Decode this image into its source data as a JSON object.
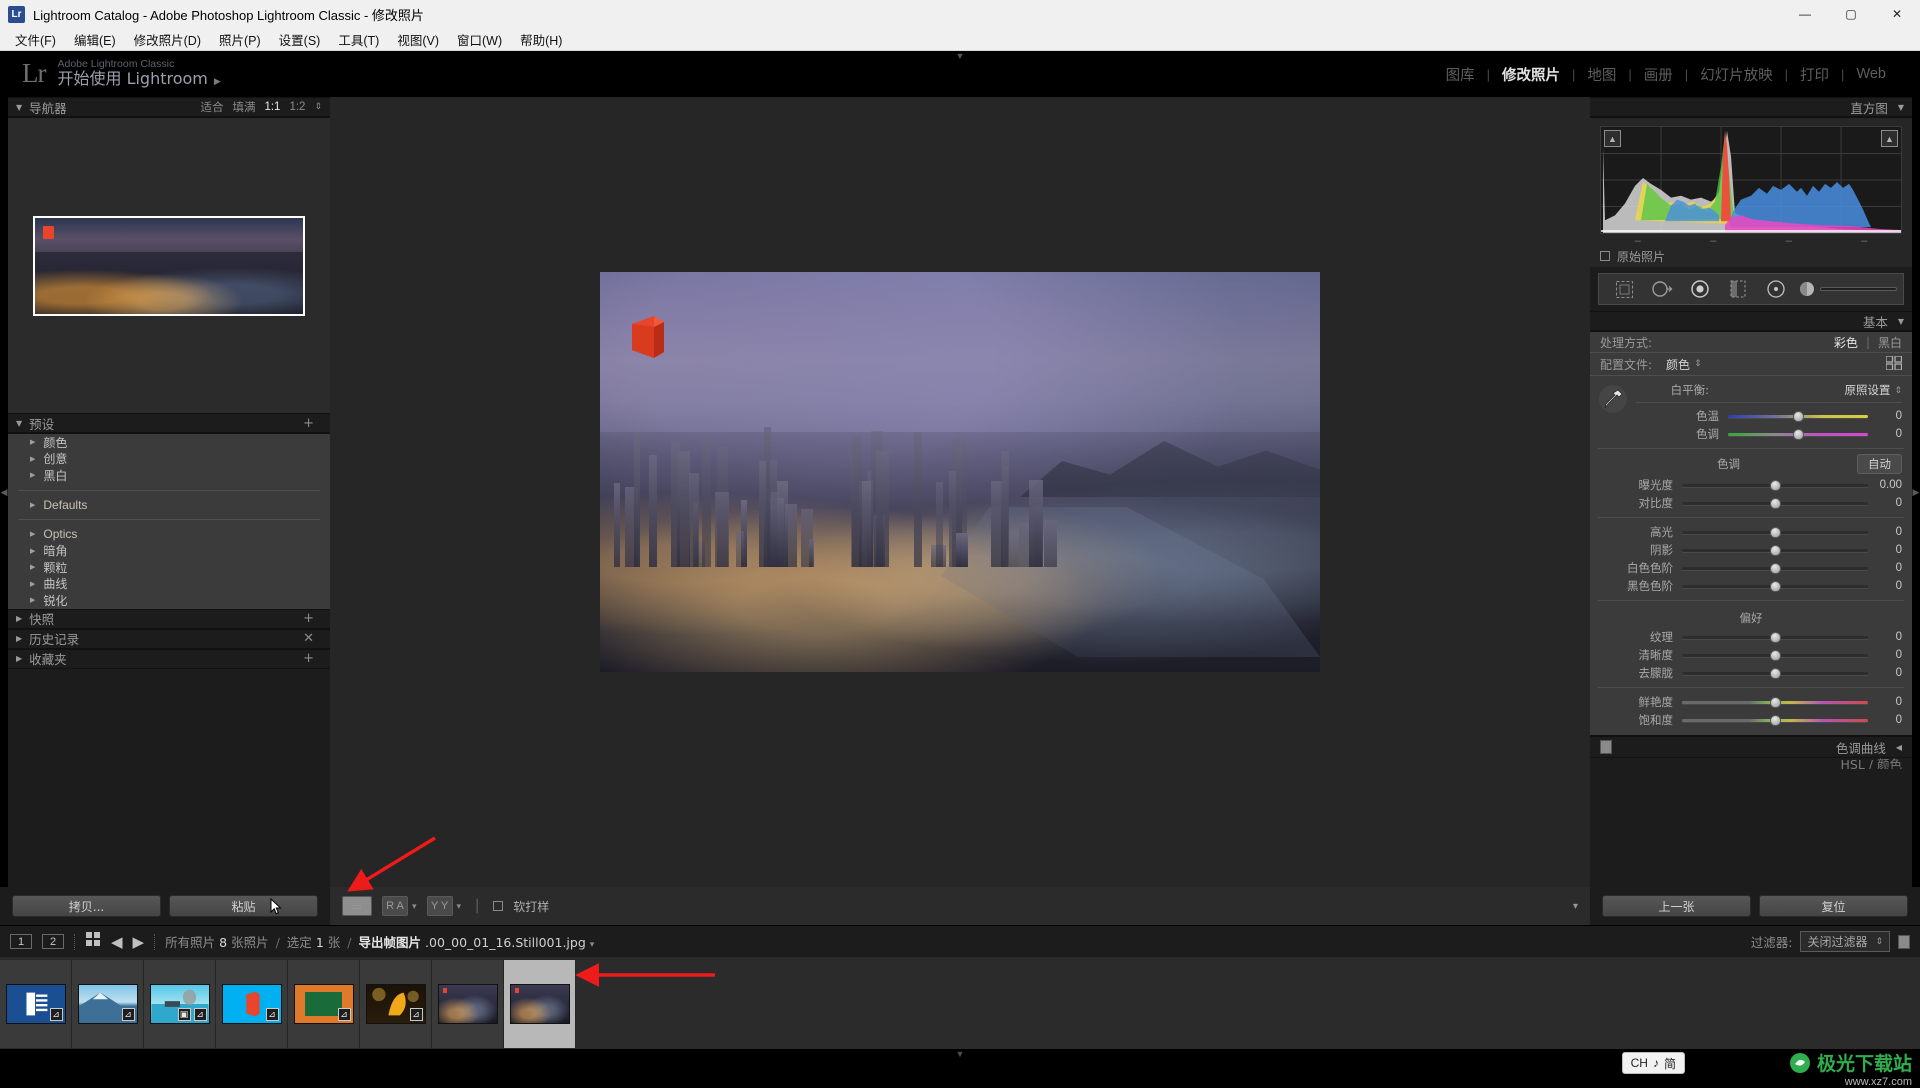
{
  "window": {
    "title": "Lightroom Catalog - Adobe Photoshop Lightroom Classic - 修改照片",
    "app_initials": "Lr",
    "minimize": "—",
    "maximize": "▢",
    "close": "✕"
  },
  "menubar": {
    "items": [
      "文件(F)",
      "编辑(E)",
      "修改照片(D)",
      "照片(P)",
      "设置(S)",
      "工具(T)",
      "视图(V)",
      "窗口(W)",
      "帮助(H)"
    ]
  },
  "identity": {
    "logo": "Lr",
    "line1": "Adobe Lightroom Classic",
    "line2": "开始使用 Lightroom",
    "arrow": "▶"
  },
  "modules": {
    "items": [
      {
        "label": "图库",
        "active": false
      },
      {
        "label": "修改照片",
        "active": true
      },
      {
        "label": "地图",
        "active": false
      },
      {
        "label": "画册",
        "active": false
      },
      {
        "label": "幻灯片放映",
        "active": false
      },
      {
        "label": "打印",
        "active": false
      },
      {
        "label": "Web",
        "active": false
      }
    ],
    "separator": "|"
  },
  "left_panel": {
    "navigator": {
      "title": "导航器",
      "zoom_modes": [
        "适合",
        "填满",
        "1:1",
        "1:2"
      ],
      "active_zoom": "1:1",
      "stepper": "⇕"
    },
    "presets": {
      "title": "预设",
      "add": "+",
      "groups": [
        {
          "label": "颜色",
          "lang": "cn"
        },
        {
          "label": "创意",
          "lang": "cn"
        },
        {
          "label": "黑白",
          "lang": "cn"
        },
        {
          "divider": true
        },
        {
          "label": "Defaults",
          "lang": "en"
        },
        {
          "divider": true
        },
        {
          "label": "Optics",
          "lang": "en"
        },
        {
          "label": "暗角",
          "lang": "cn"
        },
        {
          "label": "颗粒",
          "lang": "cn"
        },
        {
          "label": "曲线",
          "lang": "cn"
        },
        {
          "label": "锐化",
          "lang": "cn"
        }
      ]
    },
    "snapshots": {
      "title": "快照",
      "add": "+"
    },
    "history": {
      "title": "历史记录",
      "clear": "✕"
    },
    "collections": {
      "title": "收藏夹",
      "add": "+"
    },
    "buttons": {
      "copy": "拷贝...",
      "paste": "粘贴"
    }
  },
  "center": {
    "toolbar": {
      "view_loupe": "▭",
      "before_after_label": "R A",
      "before_after_caret": "▾",
      "yy_label": "Y Y",
      "yy_caret": "▾",
      "softproof_label": "软打样",
      "collapse_caret": "▾"
    }
  },
  "right_panel": {
    "histogram": {
      "title": "直方图",
      "collapse": "▼",
      "clip_shadow": "▲",
      "clip_highlight": "▲",
      "original_photo": "原始照片"
    },
    "tools": [
      "crop-icon",
      "spot-removal-icon",
      "red-eye-icon",
      "graduated-filter-icon",
      "radial-filter-icon",
      "adjustment-brush-icon"
    ],
    "basic": {
      "title": "基本",
      "collapse": "▼",
      "treatment_label": "处理方式:",
      "treatment_color": "彩色",
      "treatment_bw": "黑白",
      "profile_label": "配置文件:",
      "profile_value": "颜色",
      "profile_stepper": "⇕",
      "profile_browser_icon": "grid-icon",
      "wb_label": "白平衡:",
      "wb_value": "原照设置",
      "wb_stepper": "⇕",
      "eyedropper": "eyedropper-icon",
      "wb_sliders": [
        {
          "label": "色温",
          "value": "0",
          "style": "temp"
        },
        {
          "label": "色调",
          "value": "0",
          "style": "tint"
        }
      ],
      "tone_title": "色调",
      "auto_button": "自动",
      "tone_sliders": [
        {
          "label": "曝光度",
          "value": "0.00"
        },
        {
          "label": "对比度",
          "value": "0"
        }
      ],
      "tone_sliders2": [
        {
          "label": "高光",
          "value": "0"
        },
        {
          "label": "阴影",
          "value": "0"
        },
        {
          "label": "白色色阶",
          "value": "0"
        },
        {
          "label": "黑色色阶",
          "value": "0"
        }
      ],
      "presence_title": "偏好",
      "presence_sliders": [
        {
          "label": "纹理",
          "value": "0"
        },
        {
          "label": "清晰度",
          "value": "0"
        },
        {
          "label": "去朦胧",
          "value": "0"
        }
      ],
      "presence_sliders2": [
        {
          "label": "鲜艳度",
          "value": "0",
          "style": "vib"
        },
        {
          "label": "饱和度",
          "value": "0",
          "style": "vib"
        }
      ]
    },
    "tone_curve": {
      "title": "色调曲线",
      "collapse": "◀"
    },
    "hsl": {
      "title": "HSL / 颜色"
    },
    "buttons": {
      "previous": "上一张",
      "reset": "复位"
    }
  },
  "filmbar": {
    "page_numbers": [
      "1",
      "2"
    ],
    "grid_icon": "grid-view-icon",
    "back_icon": "◀",
    "forward_icon": "▶",
    "breadcrumb": {
      "source": "所有照片",
      "count": "8",
      "count_unit": "张照片",
      "selected_label": "选定",
      "selected_count": "1",
      "selected_unit": "张",
      "folder": "导出帧图片",
      "filename": ".00_00_01_16.Still001.jpg",
      "caret": "▾"
    },
    "filter_label": "过滤器:",
    "filter_value": "关闭过滤器",
    "filter_stepper": "⇕"
  },
  "filmstrip": {
    "thumbnails": [
      {
        "name": "word-document-thumb",
        "kind": "word",
        "edited": true,
        "selected": false
      },
      {
        "name": "mountain-lake-thumb",
        "kind": "mountain",
        "edited": true,
        "selected": false
      },
      {
        "name": "beach-boat-thumb",
        "kind": "beach",
        "edited": true,
        "selected": false,
        "stacked": true
      },
      {
        "name": "office-blue-thumb",
        "kind": "office",
        "edited": true,
        "selected": false
      },
      {
        "name": "green-frame-thumb",
        "kind": "greenframe",
        "edited": true,
        "selected": false
      },
      {
        "name": "yellow-leaf-thumb",
        "kind": "leaf",
        "edited": true,
        "selected": false
      },
      {
        "name": "cityscape-thumb",
        "kind": "city",
        "edited": false,
        "selected": false
      },
      {
        "name": "cityscape-selected-thumb",
        "kind": "city",
        "edited": false,
        "selected": true
      }
    ]
  },
  "status": {
    "ime_lang": "CH",
    "ime_note": "♪",
    "ime_mode": "简",
    "watermark_main": "极光下载站",
    "watermark_sub": "www.xz7.com"
  },
  "colors": {
    "panel_bg": "#1c1c1c",
    "panel_body": "#3b3b3b",
    "center_bg": "#262626",
    "accent_text": "#e2e2e2",
    "annotation_red": "#ee1b1b"
  }
}
